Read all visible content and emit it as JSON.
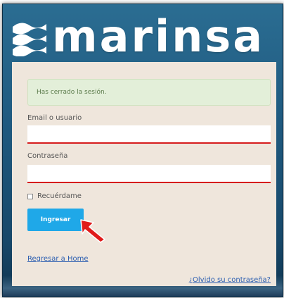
{
  "brand": {
    "name": "marinsa",
    "logo_icon": "waves-icon"
  },
  "login": {
    "alert_message": "Has cerrado la sesión.",
    "email_label": "Email o usuario",
    "email_value": "",
    "password_label": "Contraseña",
    "password_value": "",
    "remember_label": "Recuérdame",
    "remember_checked": false,
    "submit_label": "Ingresar",
    "home_link": "Regresar a Home",
    "forgot_link": "¿Olvido su contraseña?"
  },
  "colors": {
    "accent": "#1fa8e8",
    "input_underline": "#d61d1d",
    "alert_bg": "#e3efd9",
    "card_bg": "#efe6dc",
    "link": "#2a5db0",
    "cursor": "#e01b1b"
  }
}
